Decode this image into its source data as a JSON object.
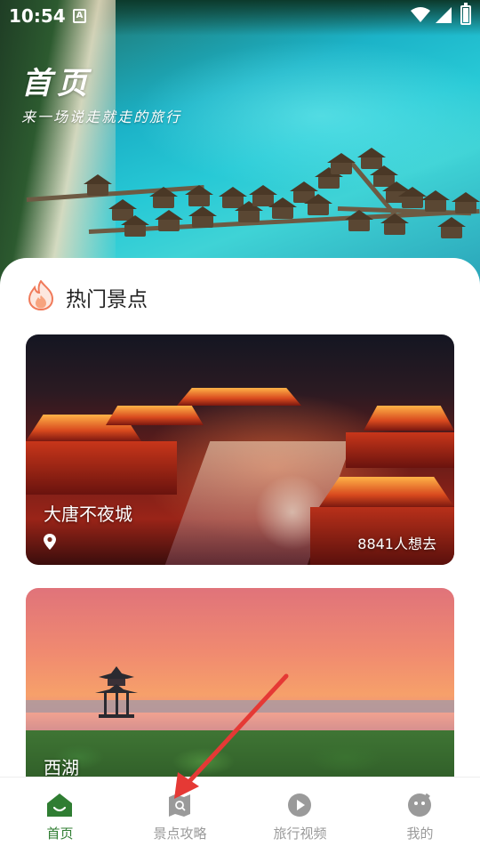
{
  "status_bar": {
    "time": "10:54",
    "notification_icon": "A"
  },
  "hero": {
    "title": "首页",
    "subtitle": "来一场说走就走的旅行"
  },
  "section": {
    "title": "热门景点",
    "icon": "flame-icon"
  },
  "cards": [
    {
      "name": "大唐不夜城",
      "visitors": "8841人想去",
      "icon": "location-icon"
    },
    {
      "name": "西湖"
    }
  ],
  "tabbar": {
    "items": [
      {
        "label": "首页",
        "icon": "home-icon",
        "active": true
      },
      {
        "label": "景点攻略",
        "icon": "map-search-icon",
        "active": false
      },
      {
        "label": "旅行视频",
        "icon": "play-icon",
        "active": false
      },
      {
        "label": "我的",
        "icon": "profile-icon",
        "active": false
      }
    ]
  },
  "colors": {
    "accent": "#2f7d32",
    "inactive": "#9a9a9a",
    "arrow": "#e53935"
  }
}
